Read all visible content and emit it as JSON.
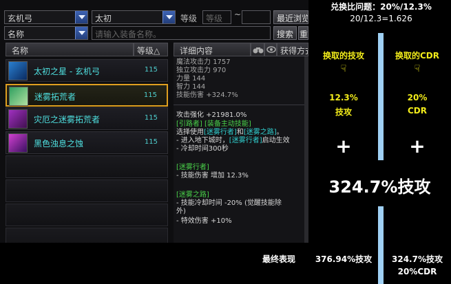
{
  "filters": {
    "class_select": "玄机弓",
    "set_select": "太初",
    "level_label": "等级",
    "level_min_placeholder": "等级",
    "level_tilde": "~",
    "recent_button": "最近浏览",
    "name_select": "名称",
    "search_placeholder": "请输入装备名称。",
    "search_button": "搜索",
    "reset_button": "重置"
  },
  "list": {
    "col_name": "名称",
    "col_level": "等级△",
    "items": [
      {
        "name": "太初之星 - 玄机弓",
        "level": "115"
      },
      {
        "name": "迷雾拓荒者",
        "level": "115"
      },
      {
        "name": "灾厄之迷雾拓荒者",
        "level": "115"
      },
      {
        "name": "黑色浊息之蚀",
        "level": "115"
      }
    ]
  },
  "detail": {
    "header": "详细内容",
    "get_button": "获得方式",
    "stats": [
      {
        "label": "魔法攻击力",
        "value": "1757"
      },
      {
        "label": "独立攻击力",
        "value": "970"
      },
      {
        "label": "力量",
        "value": "144"
      },
      {
        "label": "智力",
        "value": "144"
      },
      {
        "label": "技能伤害",
        "value": "+324.7%"
      }
    ],
    "atk_boost": "攻击强化 +21981.0%",
    "pioneer_title": "[引路者] [装备主动技能]",
    "choose_prefix": "选择使用",
    "choose_a": "[迷雾行者]",
    "choose_mid": "和",
    "choose_b": "[迷雾之路]",
    "choose_suffix": "。",
    "enter_prefix": "- 进入地下城时，",
    "enter_skill": "[迷雾行者]",
    "enter_suffix": "启动生效",
    "cooldown": "- 冷却时间300秒",
    "walker_title": "[迷雾行者]",
    "walker_line": "- 技能伤害 增加 12.3%",
    "road_title": "[迷雾之路]",
    "road_line1": "- 技能冷却时间 -20% (觉醒技能除",
    "road_line2": "外)",
    "road_line3": "- 特效伤害 +10%"
  },
  "annotation": {
    "title": "兑换比问题：20%/12.3%",
    "ratio": "20/12.3=1.626",
    "left_head": "换取的技攻",
    "right_head": "换取的CDR",
    "hand_glyph": "☟",
    "left_val": "12.3%",
    "left_unit": "技攻",
    "right_val": "20%",
    "right_unit": "CDR",
    "plus": "+",
    "big_value": "324.7%技攻",
    "final_label": "最终表现",
    "final_left": "376.94%技攻",
    "final_right1": "324.7%技攻",
    "final_right2": "20%CDR"
  },
  "colors": {
    "accent_yellow": "#f2ec1a",
    "bar_blue": "#9fd0f4",
    "item_cyan": "#4fe0e0",
    "text_green": "#4ad24a",
    "select_border": "#e0a020"
  }
}
